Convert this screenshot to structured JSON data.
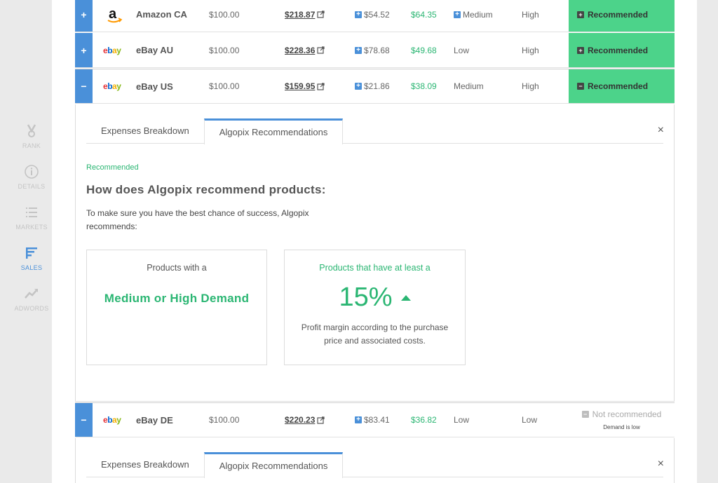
{
  "sidebar": [
    {
      "label": "RANK",
      "icon": "medal-icon"
    },
    {
      "label": "DETAILS",
      "icon": "info-icon"
    },
    {
      "label": "MARKETS",
      "icon": "list-icon"
    },
    {
      "label": "SALES",
      "icon": "sales-icon",
      "active": true
    },
    {
      "label": "ADWORDS",
      "icon": "trend-icon"
    }
  ],
  "rows": [
    {
      "toggle": "+",
      "logo": "amazon",
      "market": "Amazon CA",
      "price": "$100.00",
      "sell": "$218.87",
      "cost": "$54.52",
      "profit": "$64.35",
      "demand": "Medium",
      "competition": "High",
      "status": "Recommended"
    },
    {
      "toggle": "+",
      "logo": "ebay",
      "market": "eBay AU",
      "price": "$100.00",
      "sell": "$228.36",
      "cost": "$78.68",
      "profit": "$49.68",
      "demand": "Low",
      "competition": "High",
      "status": "Recommended"
    },
    {
      "toggle": "−",
      "logo": "ebay",
      "market": "eBay US",
      "price": "$100.00",
      "sell": "$159.95",
      "cost": "$21.86",
      "profit": "$38.09",
      "demand": "Medium",
      "competition": "High",
      "status": "Recommended"
    },
    {
      "toggle": "−",
      "logo": "ebay",
      "market": "eBay DE",
      "price": "$100.00",
      "sell": "$220.23",
      "cost": "$83.41",
      "profit": "$36.82",
      "demand": "Low",
      "competition": "Low",
      "status": "Not recommended",
      "status_sub": "Demand is low"
    }
  ],
  "panel": {
    "tab1": "Expenses Breakdown",
    "tab2": "Algopix Recommendations",
    "close": "×",
    "label": "Recommended",
    "heading": "How does Algopix recommend products:",
    "description": "To make sure you have the best chance of success, Algopix recommends:",
    "card1_top": "Products with a",
    "card1_big": "Medium or High Demand",
    "card2_top": "Products that have at least a",
    "card2_pct": "15%",
    "card2_bottom": "Profit margin according to the purchase price and associated costs."
  },
  "panel2": {
    "tab1": "Expenses Breakdown",
    "tab2": "Algopix Recommendations",
    "close": "×"
  },
  "colors": {
    "accent": "#4a90d9",
    "green": "#2bb673",
    "rec_bg": "#4cd38a"
  }
}
